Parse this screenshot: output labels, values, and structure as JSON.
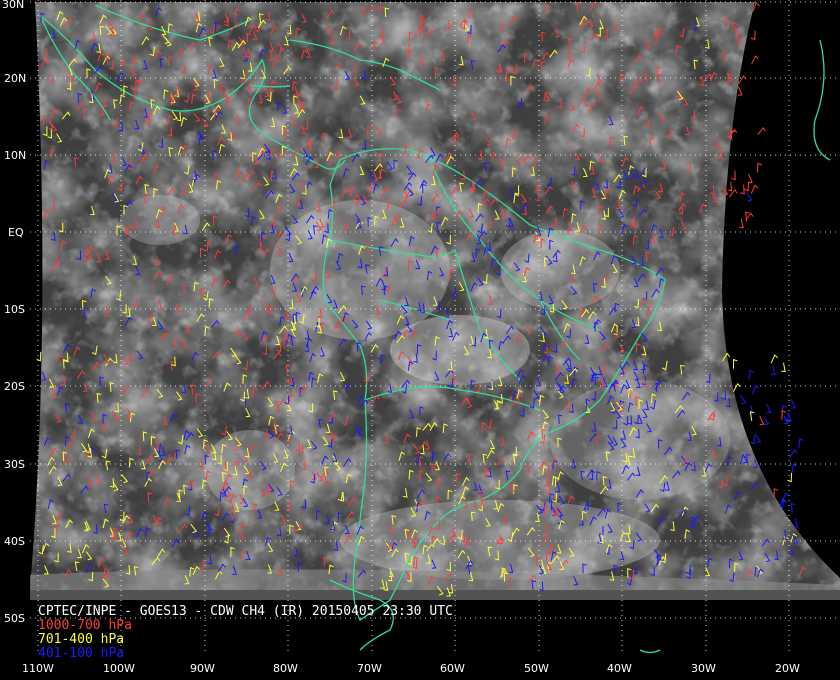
{
  "caption": {
    "title": "CPTEC/INPE - GOES13 - CDW CH4 (IR) 20150405 23:30 UTC"
  },
  "legend": [
    {
      "label": "1000-700 hPa",
      "color": "#ff3b3b"
    },
    {
      "label": "701-400 hPa",
      "color": "#ffff33"
    },
    {
      "label": "401-100 hPa",
      "color": "#1a1aff"
    }
  ],
  "latitude_labels": [
    "30N",
    "20N",
    "10N",
    "EQ",
    "10S",
    "20S",
    "30S",
    "40S",
    "50S"
  ],
  "longitude_labels": [
    "110W",
    "100W",
    "90W",
    "80W",
    "70W",
    "60W",
    "50W",
    "40W",
    "30W",
    "20W"
  ],
  "colors": {
    "background": "#000000",
    "coastline": "#33dd99",
    "grid": "#ffffff"
  }
}
